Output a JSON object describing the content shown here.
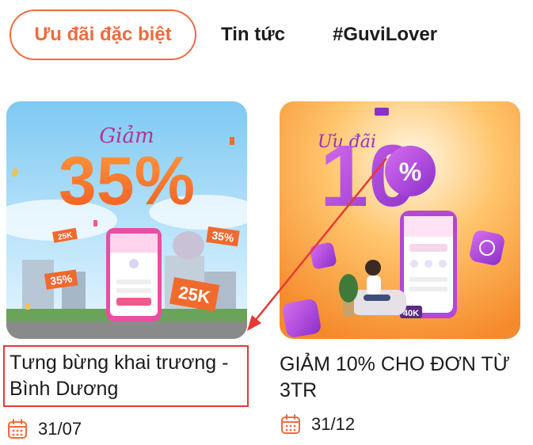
{
  "tabs": [
    {
      "label": "Ưu đãi đặc biệt",
      "active": true
    },
    {
      "label": "Tin tức",
      "active": false
    },
    {
      "label": "#GuviLover",
      "active": false
    }
  ],
  "cards": [
    {
      "title": "Tưng bừng khai trương - Bình Dương",
      "date": "31/07",
      "banner": {
        "headline": "Giảm",
        "big": "35%",
        "tag1": "25K",
        "tag2": "35%",
        "tag3": "35%",
        "tag4": "25K"
      }
    },
    {
      "title": "GIẢM 10% CHO ĐƠN TỪ 3TR",
      "date": "31/12",
      "banner": {
        "headline": "Ưu đãi",
        "big": "10",
        "pct": "%",
        "tag": "40K"
      }
    }
  ],
  "colors": {
    "accent": "#f26a3c",
    "highlight_box": "#e53935"
  }
}
